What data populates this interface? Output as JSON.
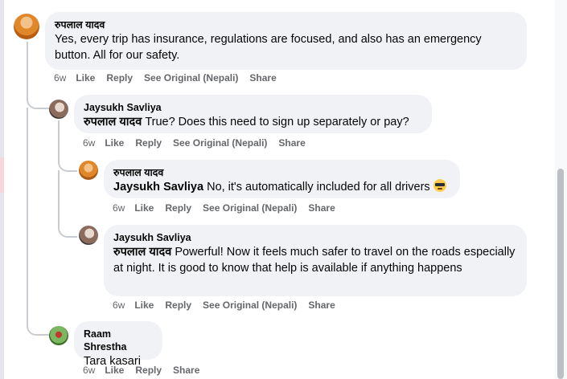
{
  "comments": [
    {
      "author": "रुपलाल यादव",
      "mention": "",
      "text": "Yes, every trip has insurance, regulations are focused, and also has an emergency button. All for our safety.",
      "time": "6w",
      "actions": [
        "Like",
        "Reply",
        "See Original (Nepali)",
        "Share"
      ]
    },
    {
      "author": "Jaysukh Savliya",
      "mention": "रुपलाल यादव",
      "text": "True? Does this need to sign up separately or pay?",
      "time": "6w",
      "actions": [
        "Like",
        "Reply",
        "See Original (Nepali)",
        "Share"
      ]
    },
    {
      "author": "रुपलाल यादव",
      "mention": "Jaysukh Savliya",
      "text": "No, it's automatically included for all drivers",
      "emoji": "smiling-face-with-sunglasses",
      "time": "6w",
      "actions": [
        "Like",
        "Reply",
        "See Original (Nepali)",
        "Share"
      ]
    },
    {
      "author": "Jaysukh Savliya",
      "mention": "रुपलाल यादव",
      "text": "Powerful! Now it feels much safer to travel on the roads especially at night. It is good to know that help is available if anything happens",
      "time": "6w",
      "actions": [
        "Like",
        "Reply",
        "See Original (Nepali)",
        "Share"
      ]
    },
    {
      "author": "Raam Shrestha",
      "mention": "",
      "text": "Tara kasari",
      "time": "6w",
      "actions": [
        "Like",
        "Reply",
        "Share"
      ]
    }
  ],
  "colors": {
    "bubble": "#f0f2f5",
    "meta_text": "#65676b",
    "thread_line": "#c9ccd1"
  }
}
